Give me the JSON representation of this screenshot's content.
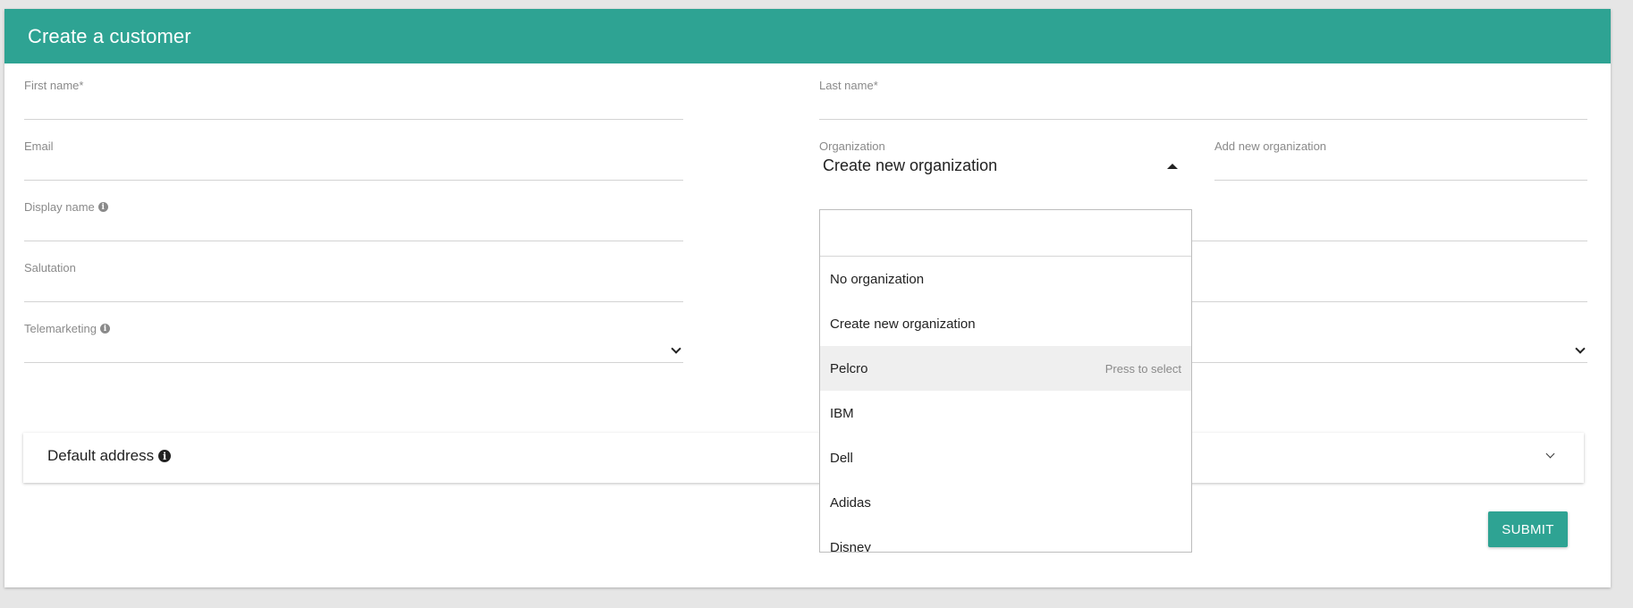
{
  "header": {
    "title": "Create a customer"
  },
  "form": {
    "first_name": {
      "label": "First name*"
    },
    "last_name": {
      "label": "Last name*"
    },
    "email": {
      "label": "Email"
    },
    "organization": {
      "label": "Organization",
      "value": "Create new organization"
    },
    "add_new_organization": {
      "label": "Add new organization"
    },
    "display_name": {
      "label": "Display name"
    },
    "salutation": {
      "label": "Salutation"
    },
    "telemarketing": {
      "label": "Telemarketing"
    }
  },
  "default_address": {
    "title": "Default address"
  },
  "submit": {
    "label": "SUBMIT"
  },
  "organization_dropdown": {
    "search_value": "",
    "options": [
      {
        "label": "No organization"
      },
      {
        "label": "Create new organization"
      },
      {
        "label": "Pelcro",
        "hint": "Press to select",
        "highlighted": true
      },
      {
        "label": "IBM"
      },
      {
        "label": "Dell"
      },
      {
        "label": "Adidas"
      },
      {
        "label": "Disney"
      }
    ]
  },
  "colors": {
    "accent": "#2ea393",
    "background": "#e6e6e6",
    "highlight": "#efefef"
  },
  "icons": [
    "info-icon",
    "chevron-down-icon",
    "caret-up-icon"
  ]
}
